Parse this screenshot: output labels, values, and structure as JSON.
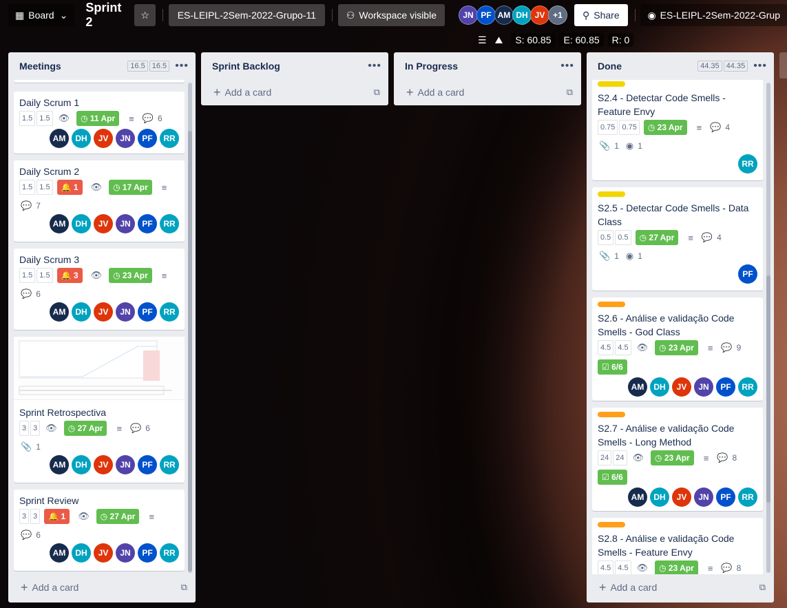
{
  "header": {
    "board_switcher": "Board",
    "board_title": "Sprint 2",
    "star_icon": "star-icon",
    "workspace": "ES-LEIPL-2Sem-2022-Grupo-11",
    "visibility": "Workspace visible",
    "extra_members": "+1",
    "share": "Share",
    "github": "ES-LEIPL-2Sem-2022-Grup"
  },
  "members": [
    {
      "initials": "JN",
      "color": "#5243aa"
    },
    {
      "initials": "PF",
      "color": "#0052cc"
    },
    {
      "initials": "AM",
      "color": "#172b4d"
    },
    {
      "initials": "DH",
      "color": "#00a3bf"
    },
    {
      "initials": "JV",
      "color": "#de350b"
    }
  ],
  "stats": {
    "s": "S: 60.85",
    "e": "E: 60.85",
    "r": "R: 0"
  },
  "card_members": [
    {
      "initials": "AM",
      "color": "#172b4d"
    },
    {
      "initials": "DH",
      "color": "#00a3bf"
    },
    {
      "initials": "JV",
      "color": "#de350b"
    },
    {
      "initials": "JN",
      "color": "#5243aa"
    },
    {
      "initials": "PF",
      "color": "#0052cc"
    },
    {
      "initials": "RR",
      "color": "#00a3bf"
    }
  ],
  "lists": {
    "meetings": {
      "title": "Meetings",
      "wip1": "16.5",
      "wip2": "16.5",
      "add": "Add a card",
      "cards": [
        {
          "title": "Daily Scrum 1",
          "e1": "1.5",
          "e2": "1.5",
          "due": "11 Apr",
          "comments": "6"
        },
        {
          "title": "Daily Scrum 2",
          "e1": "1.5",
          "e2": "1.5",
          "bell": "1",
          "due": "17 Apr",
          "comments": "7"
        },
        {
          "title": "Daily Scrum 3",
          "e1": "1.5",
          "e2": "1.5",
          "bell": "3",
          "due": "23 Apr",
          "comments": "6"
        },
        {
          "title": "Sprint Retrospectiva",
          "e1": "3",
          "e2": "3",
          "due": "27 Apr",
          "comments": "6",
          "attach": "1"
        },
        {
          "title": "Sprint Review",
          "e1": "3",
          "e2": "3",
          "bell": "1",
          "due": "27 Apr",
          "comments": "6"
        }
      ]
    },
    "backlog": {
      "title": "Sprint Backlog",
      "add": "Add a card"
    },
    "progress": {
      "title": "In Progress",
      "add": "Add a card"
    },
    "done": {
      "title": "Done",
      "wip1": "44.35",
      "wip2": "44.35",
      "add": "Add a card",
      "cards": [
        {
          "label": "#f2d600",
          "title": "S2.4 - Detectar Code Smells - Feature Envy",
          "e1": "0.75",
          "e2": "0.75",
          "due": "23 Apr",
          "comments": "4",
          "attach": "1",
          "gh": "1",
          "member": "RR"
        },
        {
          "label": "#f2d600",
          "title": "S2.5 - Detectar Code Smells - Data Class",
          "e1": "0.5",
          "e2": "0.5",
          "due": "27 Apr",
          "comments": "4",
          "attach": "1",
          "gh": "1",
          "member": "PF"
        },
        {
          "label": "#ff9f1a",
          "title": "S2.6 - Análise e validação Code Smells - God Class",
          "e1": "4.5",
          "e2": "4.5",
          "due": "23 Apr",
          "comments": "9",
          "checklist": "6/6"
        },
        {
          "label": "#ff9f1a",
          "title": "S2.7 - Análise e validação Code Smells - Long Method",
          "e1": "24",
          "e2": "24",
          "due": "23 Apr",
          "comments": "8",
          "checklist": "6/6"
        },
        {
          "label": "#ff9f1a",
          "title": "S2.8 - Análise e validação Code Smells - Feature Envy",
          "e1": "4.5",
          "e2": "4.5",
          "due": "23 Apr",
          "comments": "8"
        }
      ]
    }
  }
}
